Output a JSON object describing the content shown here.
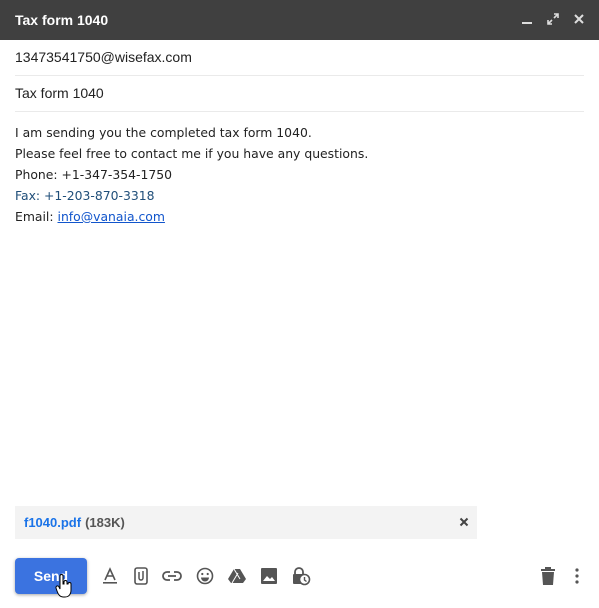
{
  "window": {
    "title": "Tax form 1040",
    "controls": [
      "minimize-icon",
      "expand-icon",
      "close-icon"
    ]
  },
  "compose": {
    "to": "13473541750@wisefax.com",
    "subject": "Tax form 1040",
    "body_lines": [
      "I am sending you the completed tax form 1040.",
      "Please feel free to contact me if you have any questions.",
      "Phone: +1-347-354-1750",
      "Fax: +1-203-870-3318"
    ],
    "email_label": "Email: ",
    "email_link": "info@vanaia.com"
  },
  "attachment": {
    "filename": "f1040.pdf",
    "size": "(183K)"
  },
  "toolbar": {
    "send_label": "Send",
    "tools": [
      "formatting-icon",
      "attach-icon",
      "link-icon",
      "emoji-icon",
      "drive-icon",
      "photo-icon",
      "confidential-icon"
    ],
    "right_tools": [
      "trash-icon",
      "more-options-icon"
    ]
  },
  "colors": {
    "titlebar": "#404040",
    "send_button": "#3b73e0",
    "link": "#1155cc",
    "attachment_name": "#1a73e8"
  }
}
